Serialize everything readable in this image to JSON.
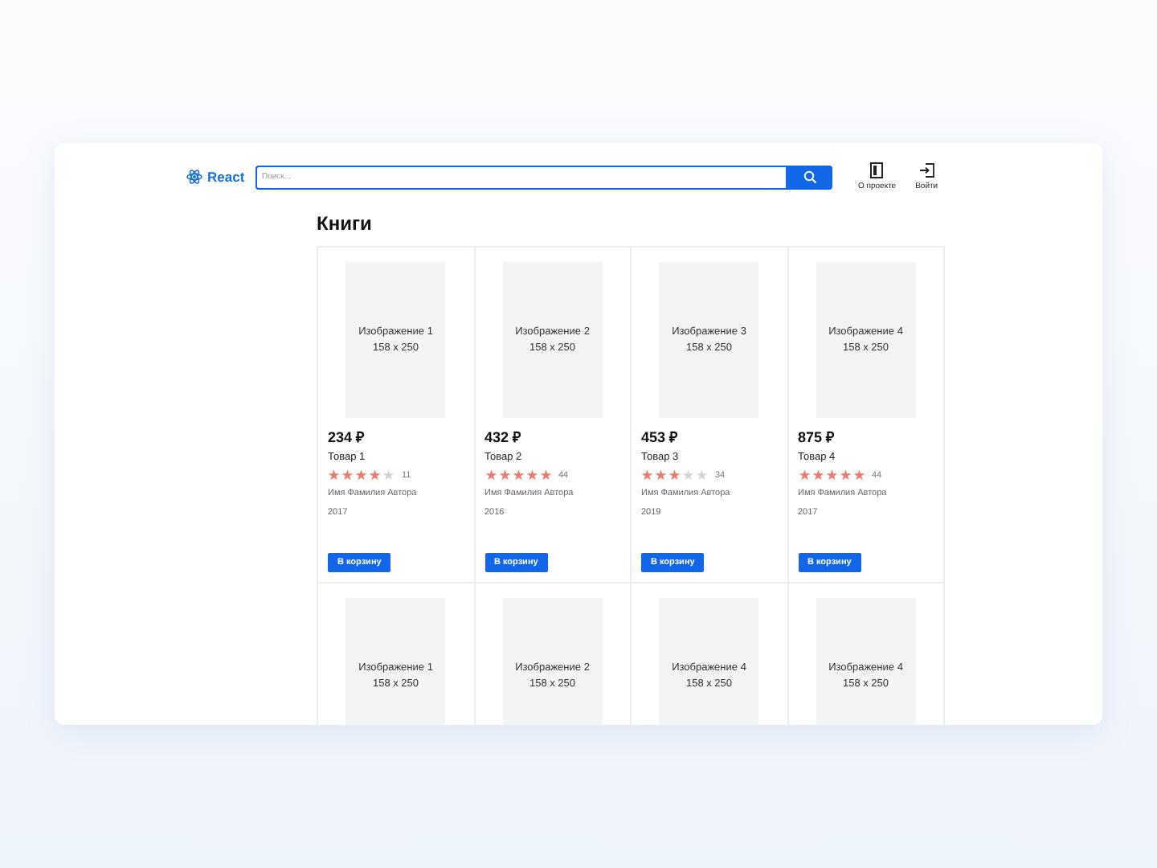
{
  "header": {
    "logo": "React",
    "search": {
      "placeholder": "Поиск..."
    },
    "nav": [
      {
        "label": "О проекте",
        "kind": "about"
      },
      {
        "label": "Войти",
        "kind": "login"
      }
    ]
  },
  "section_title": "Книги",
  "products": [
    {
      "image_label": "Изображение 1",
      "image_size": "158 x 250",
      "price": "234 ₽",
      "name": "Товар 1",
      "stars": 4,
      "reviews": "11",
      "author": "Имя Фамилия Автора",
      "year": "2017",
      "button": "В корзину"
    },
    {
      "image_label": "Изображение 2",
      "image_size": "158 x 250",
      "price": "432 ₽",
      "name": "Товар 2",
      "stars": 5,
      "reviews": "44",
      "author": "Имя Фамилия Автора",
      "year": "2016",
      "button": "В корзину"
    },
    {
      "image_label": "Изображение 3",
      "image_size": "158 x 250",
      "price": "453 ₽",
      "name": "Товар 3",
      "stars": 3,
      "reviews": "34",
      "author": "Имя Фамилия Автора",
      "year": "2019",
      "button": "В корзину"
    },
    {
      "image_label": "Изображение 4",
      "image_size": "158 x 250",
      "price": "875 ₽",
      "name": "Товар 4",
      "stars": 5,
      "reviews": "44",
      "author": "Имя Фамилия Автора",
      "year": "2017",
      "button": "В корзину"
    },
    {
      "image_label": "Изображение 1",
      "image_size": "158 x 250"
    },
    {
      "image_label": "Изображение 2",
      "image_size": "158 x 250"
    },
    {
      "image_label": "Изображение 4",
      "image_size": "158 x 250"
    },
    {
      "image_label": "Изображение 4",
      "image_size": "158 x 250"
    }
  ]
}
